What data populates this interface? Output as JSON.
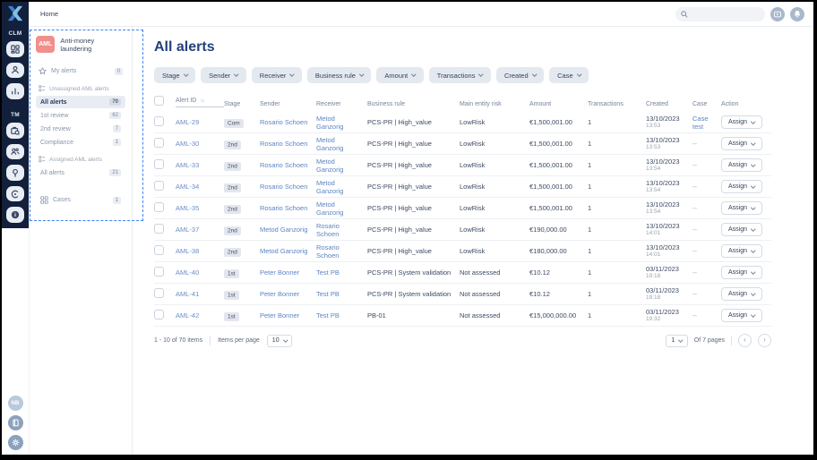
{
  "header": {
    "breadcrumb": "Home",
    "search_placeholder": ""
  },
  "rail": {
    "clm_label": "CLM",
    "tm_label": "TM",
    "user_initials": "NB"
  },
  "sidebar": {
    "app_badge": "AML",
    "app_title": "Anti-money laundering",
    "my_alerts_label": "My alerts",
    "my_alerts_count": "0",
    "unassigned_section": "Unassigned AML alerts",
    "unassigned_items": [
      {
        "label": "All alerts",
        "count": "70",
        "selected": true
      },
      {
        "label": "1st review",
        "count": "62"
      },
      {
        "label": "2nd review",
        "count": "7"
      },
      {
        "label": "Compliance",
        "count": "1"
      }
    ],
    "assigned_section": "Assigned AML alerts",
    "assigned_items": [
      {
        "label": "All alerts",
        "count": "21"
      }
    ],
    "cases_label": "Cases",
    "cases_count": "1"
  },
  "main": {
    "title": "All alerts",
    "filters": [
      "Stage",
      "Sender",
      "Receiver",
      "Business rule",
      "Amount",
      "Transactions",
      "Created",
      "Case"
    ],
    "table": {
      "headers": {
        "alert_id": "Alert ID",
        "stage": "Stage",
        "sender": "Sender",
        "receiver": "Receiver",
        "business_rule": "Business rule",
        "main_entity_risk": "Main entity risk",
        "amount": "Amount",
        "transactions": "Transactions",
        "created": "Created",
        "case": "Case",
        "action": "Action"
      },
      "action_label": "Assign",
      "rows": [
        {
          "id": "AML-29",
          "stage": "Com",
          "sender": "Rosario Schoen",
          "receiver": "Metod Ganzorig",
          "rule": "PCS-PR | High_value",
          "risk": "LowRisk",
          "amount": "€1,500,001.00",
          "transactions": "1",
          "created_date": "13/10/2023",
          "created_time": "13:53",
          "case": "Case test",
          "case_link": true
        },
        {
          "id": "AML-30",
          "stage": "2nd",
          "sender": "Rosario Schoen",
          "receiver": "Metod Ganzorig",
          "rule": "PCS-PR | High_value",
          "risk": "LowRisk",
          "amount": "€1,500,001.00",
          "transactions": "1",
          "created_date": "13/10/2023",
          "created_time": "13:53",
          "case": "--",
          "case_link": false
        },
        {
          "id": "AML-33",
          "stage": "2nd",
          "sender": "Rosario Schoen",
          "receiver": "Metod Ganzorig",
          "rule": "PCS-PR | High_value",
          "risk": "LowRisk",
          "amount": "€1,500,001.00",
          "transactions": "1",
          "created_date": "13/10/2023",
          "created_time": "13:54",
          "case": "--",
          "case_link": false
        },
        {
          "id": "AML-34",
          "stage": "2nd",
          "sender": "Rosario Schoen",
          "receiver": "Metod Ganzorig",
          "rule": "PCS-PR | High_value",
          "risk": "LowRisk",
          "amount": "€1,500,001.00",
          "transactions": "1",
          "created_date": "13/10/2023",
          "created_time": "13:54",
          "case": "--",
          "case_link": false
        },
        {
          "id": "AML-35",
          "stage": "2nd",
          "sender": "Rosario Schoen",
          "receiver": "Metod Ganzorig",
          "rule": "PCS-PR | High_value",
          "risk": "LowRisk",
          "amount": "€1,500,001.00",
          "transactions": "1",
          "created_date": "13/10/2023",
          "created_time": "13:54",
          "case": "--",
          "case_link": false
        },
        {
          "id": "AML-37",
          "stage": "2nd",
          "sender": "Metod Ganzorig",
          "receiver": "Rosario Schoen",
          "rule": "PCS-PR | High_value",
          "risk": "LowRisk",
          "amount": "€190,000.00",
          "transactions": "1",
          "created_date": "13/10/2023",
          "created_time": "14:01",
          "case": "--",
          "case_link": false
        },
        {
          "id": "AML-38",
          "stage": "2nd",
          "sender": "Metod Ganzorig",
          "receiver": "Rosario Schoen",
          "rule": "PCS-PR | High_value",
          "risk": "LowRisk",
          "amount": "€180,000.00",
          "transactions": "1",
          "created_date": "13/10/2023",
          "created_time": "14:01",
          "case": "--",
          "case_link": false
        },
        {
          "id": "AML-40",
          "stage": "1st",
          "sender": "Peter Bonner",
          "receiver": "Test PB",
          "rule": "PCS-PR | System validation",
          "risk": "Not assessed",
          "amount": "€10.12",
          "transactions": "1",
          "created_date": "03/11/2023",
          "created_time": "19:18",
          "case": "--",
          "case_link": false
        },
        {
          "id": "AML-41",
          "stage": "1st",
          "sender": "Peter Bonner",
          "receiver": "Test PB",
          "rule": "PCS-PR | System validation",
          "risk": "Not assessed",
          "amount": "€10.12",
          "transactions": "1",
          "created_date": "03/11/2023",
          "created_time": "19:18",
          "case": "--",
          "case_link": false
        },
        {
          "id": "AML-42",
          "stage": "1st",
          "sender": "Peter Bonner",
          "receiver": "Test PB",
          "rule": "PB-01",
          "risk": "Not assessed",
          "amount": "€15,000,000.00",
          "transactions": "1",
          "created_date": "03/11/2023",
          "created_time": "19:32",
          "case": "--",
          "case_link": false
        }
      ]
    },
    "pagination": {
      "range_text": "1 - 10 of 70 items",
      "per_page_label": "Items per page",
      "per_page_value": "10",
      "page_value": "1",
      "pages_text": "Of 7 pages"
    }
  }
}
